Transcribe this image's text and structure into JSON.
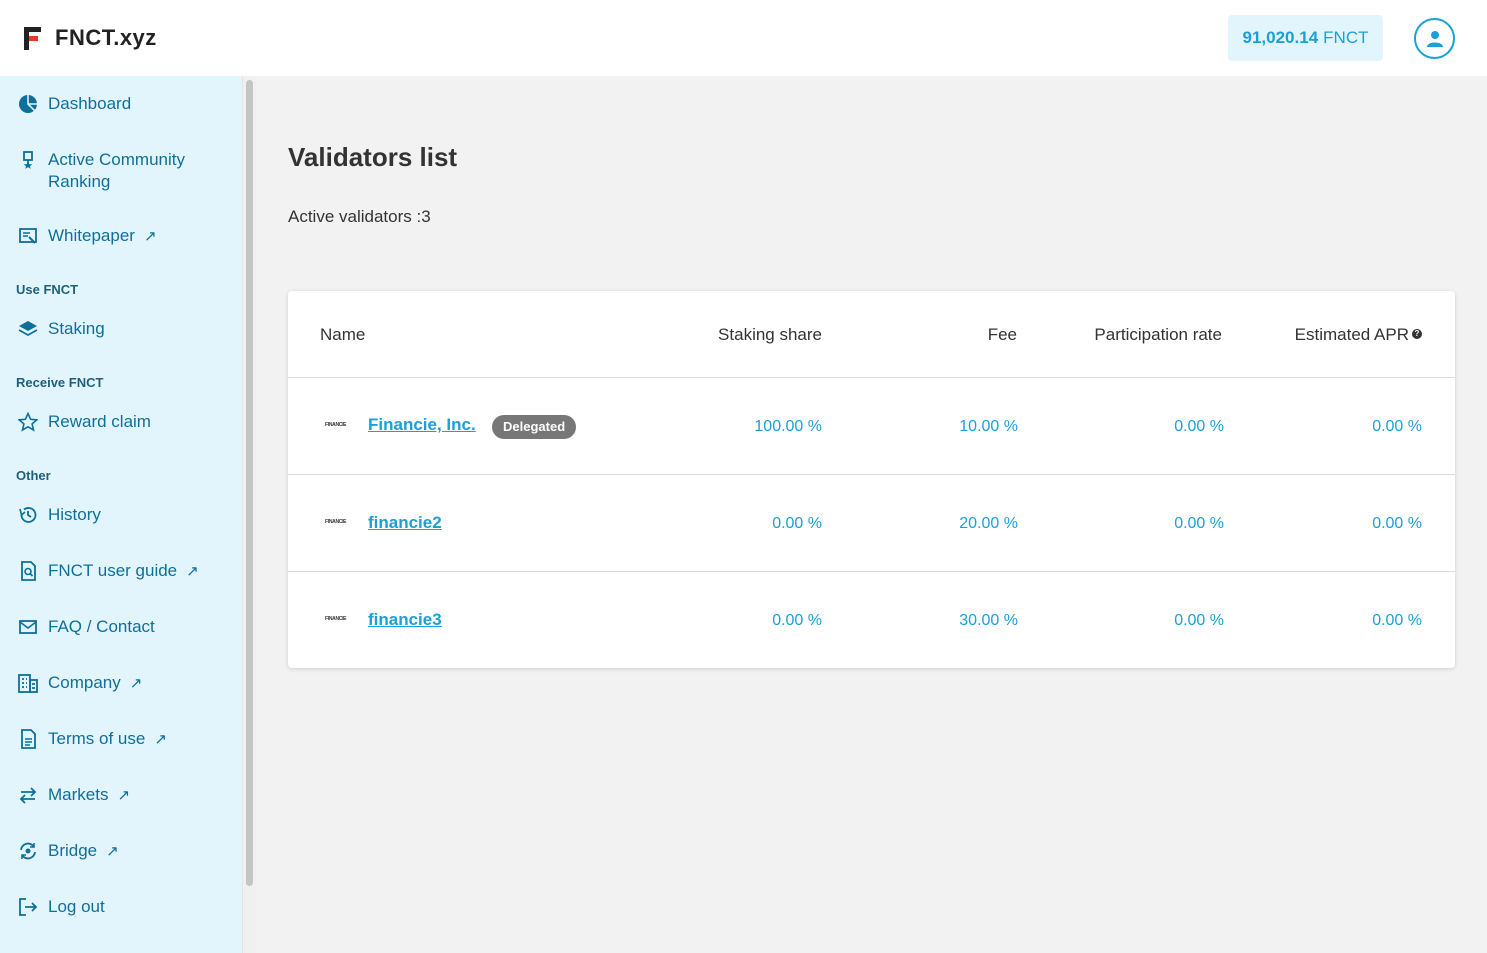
{
  "header": {
    "logo_text": "FNCT.xyz",
    "balance_amount": "91,020.14",
    "balance_unit": "FNCT"
  },
  "sidebar": {
    "items": [
      {
        "label": "Dashboard",
        "icon": "pie-chart-icon"
      },
      {
        "label": "Active Community",
        "label2": "Ranking",
        "icon": "medal-icon"
      },
      {
        "label": "Whitepaper",
        "icon": "document-icon",
        "external": true
      },
      {
        "label": "Staking",
        "icon": "layers-icon"
      },
      {
        "label": "Reward claim",
        "icon": "star-icon"
      },
      {
        "label": "History",
        "icon": "history-icon"
      },
      {
        "label": "FNCT user guide",
        "icon": "guide-icon",
        "external": true
      },
      {
        "label": "FAQ / Contact",
        "icon": "mail-icon"
      },
      {
        "label": "Company",
        "icon": "building-icon",
        "external": true
      },
      {
        "label": "Terms of use",
        "icon": "terms-icon",
        "external": true
      },
      {
        "label": "Markets",
        "icon": "arrows-icon",
        "external": true
      },
      {
        "label": "Bridge",
        "icon": "bridge-icon",
        "external": true
      },
      {
        "label": "Log out",
        "icon": "logout-icon"
      }
    ],
    "sections": [
      "Use FNCT",
      "Receive FNCT",
      "Other"
    ],
    "external_arrow": "↗"
  },
  "main": {
    "title": "Validators list",
    "active_validators": "Active validators :3",
    "table": {
      "headers": [
        "Name",
        "Staking share",
        "Fee",
        "Participation rate",
        "Estimated APR"
      ],
      "help_glyph": "?",
      "rows": [
        {
          "logo": "FINANCIE",
          "name": "Financie, Inc.",
          "badge": "Delegated",
          "share": "100.00 %",
          "fee": "10.00 %",
          "participation": "0.00 %",
          "apr": "0.00 %"
        },
        {
          "logo": "FINANCIE",
          "name": "financie2",
          "share": "0.00 %",
          "fee": "20.00 %",
          "participation": "0.00 %",
          "apr": "0.00 %"
        },
        {
          "logo": "FINANCIE",
          "name": "financie3",
          "share": "0.00 %",
          "fee": "30.00 %",
          "participation": "0.00 %",
          "apr": "0.00 %"
        }
      ]
    }
  },
  "colors": {
    "accent": "#1aa0d8",
    "nav_text": "#0e6f9a",
    "sidebar_bg": "#e3f5fc",
    "badge_bg": "#777777",
    "logo_red": "#e8392b"
  }
}
